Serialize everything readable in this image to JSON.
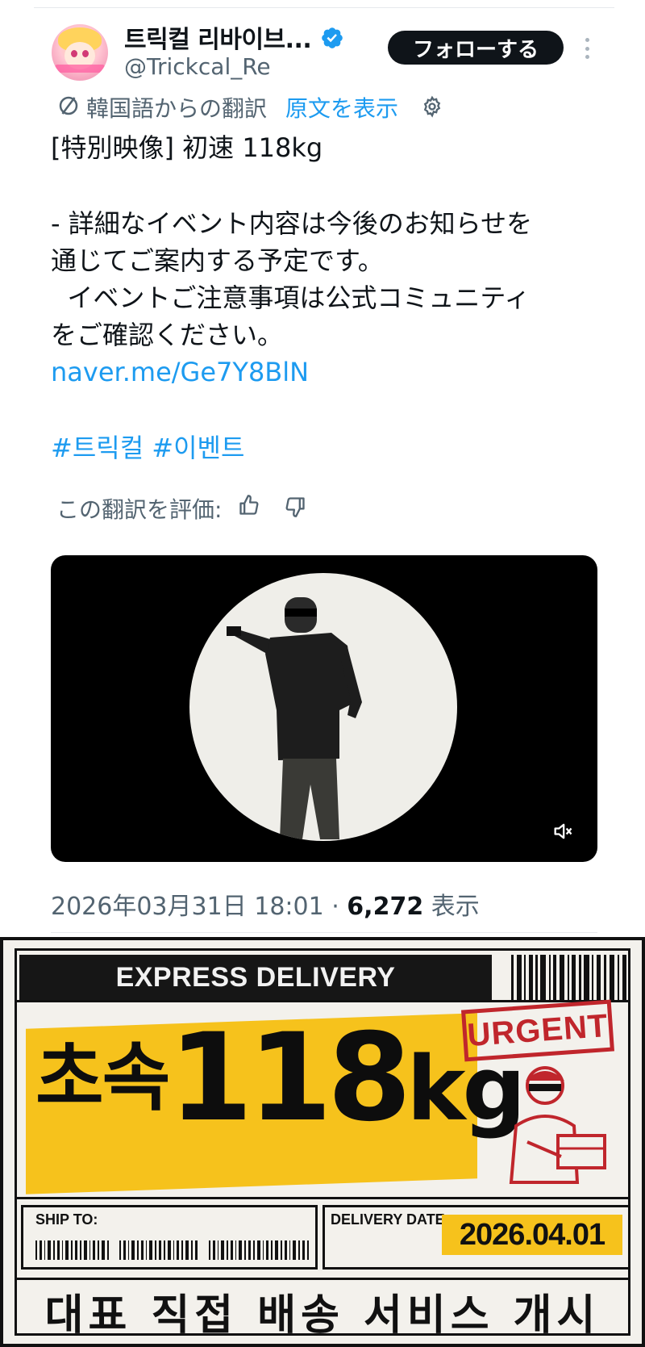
{
  "header": {
    "display_name": "트릭컬 리바이브...",
    "handle": "@Trickcal_Re",
    "follow_label": "フォローする"
  },
  "translation": {
    "label": "韓国語からの翻訳",
    "show_original": "原文を表示"
  },
  "post": {
    "title": "[特別映像] 初速 118kg",
    "body_lines": [
      "- 詳細なイベント内容は今後のお知らせを",
      "通じてご案内する予定です。",
      "  イベントご注意事項は公式コミュニティ",
      "をご確認ください。"
    ],
    "link": "naver.me/Ge7Y8BlN",
    "hashtags": "#트릭컬 #이벤트"
  },
  "rating": {
    "label": "この翻訳を評価:"
  },
  "meta": {
    "datetime": "2026年03月31日 18:01 · ",
    "views": "6,272",
    "views_label": " 表示"
  },
  "card": {
    "express": "EXPRESS DELIVERY",
    "title_kr": "초속",
    "title_num": "118",
    "title_unit": "kg",
    "urgent": "URGENT",
    "ship_to": "SHIP TO:",
    "delivery_date_label": "DELIVERY DATE:",
    "delivery_date": "2026.04.01",
    "slogan": "대표 직접 배송 서비스 개시"
  },
  "colors": {
    "link": "#1d9bf0",
    "follow_bg": "#0f1419",
    "card_yellow": "#f6c21c",
    "urgent_red": "#c0262c"
  },
  "icons": [
    "verified-badge-icon",
    "more-icon",
    "translate-icon",
    "gear-icon",
    "thumbs-up-icon",
    "thumbs-down-icon",
    "muted-speaker-icon"
  ]
}
